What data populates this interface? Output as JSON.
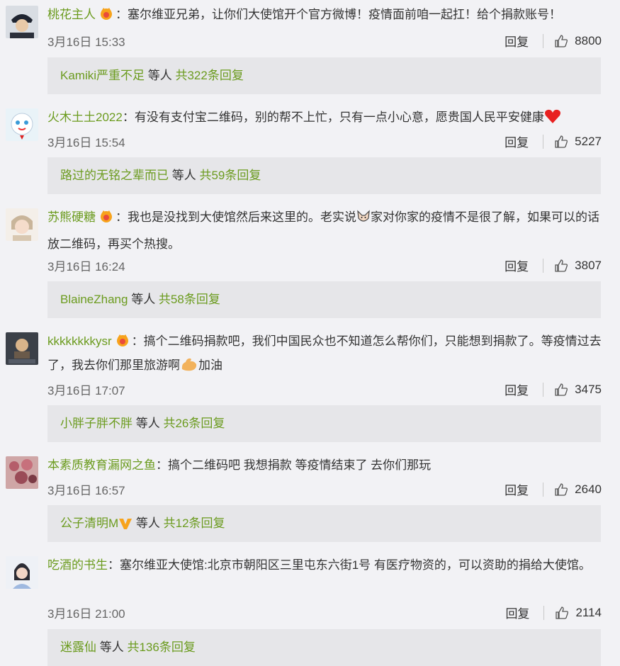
{
  "comments": [
    {
      "username": "桃花主人",
      "text": "：塞尔维亚兄弟，让你们大使馆开个官方微博！疫情面前咱一起扛！给个捐款账号！",
      "time": "3月16日 15:33",
      "reply_label": "回复",
      "likes": "8800",
      "replies": {
        "user": "Kamiki严重不足",
        "mid": " 等人 ",
        "count": "共322条回复"
      }
    },
    {
      "username": "火木土土2022",
      "text": "：有没有支付宝二维码，别的帮不上忙，只有一点小心意，愿贵国人民平安健康",
      "time": "3月16日 15:54",
      "reply_label": "回复",
      "likes": "5227",
      "replies": {
        "user": "路过的无铭之辈而已",
        "mid": " 等人 ",
        "count": "共59条回复"
      }
    },
    {
      "username": "苏熊硬糖",
      "text_a": "：我也是没找到大使馆然后来这里的。老实说",
      "text_b": "家对你家的疫情不是很了解，如果可以的话放二维码，再买个热搜。",
      "time": "3月16日 16:24",
      "reply_label": "回复",
      "likes": "3807",
      "replies": {
        "user": "BlaineZhang",
        "mid": " 等人 ",
        "count": "共58条回复"
      }
    },
    {
      "username": "kkkkkkkkysr",
      "text_a": "：搞个二维码捐款吧，我们中国民众也不知道怎么帮你们，只能想到捐款了。等疫情过去了，我去你们那里旅游啊",
      "text_b": "加油",
      "time": "3月16日 17:07",
      "reply_label": "回复",
      "likes": "3475",
      "replies": {
        "user": "小胖子胖不胖",
        "mid": " 等人 ",
        "count": "共26条回复"
      }
    },
    {
      "username": "本素质教育漏网之鱼",
      "text": "：搞个二维码吧 我想捐款 等疫情结束了 去你们那玩",
      "time": "3月16日 16:57",
      "reply_label": "回复",
      "likes": "2640",
      "replies": {
        "user": "公子清明M",
        "mid": " 等人 ",
        "count": "共12条回复"
      }
    },
    {
      "username": "吃酒的书生",
      "text": "：塞尔维亚大使馆:北京市朝阳区三里屯东六街1号 有医疗物资的，可以资助的捐给大使馆。",
      "time": "3月16日 21:00",
      "reply_label": "回复",
      "likes": "2114",
      "replies": {
        "user": "迷露仙",
        "mid": " 等人 ",
        "count": "共136条回复"
      }
    }
  ],
  "colors": {
    "username": "#6b9b1e",
    "reply_bg": "#e6e6e9",
    "page_bg": "#f2f2f5"
  },
  "icons": {
    "like": "thumbs-up-icon",
    "vip": "vip-crown-badge-icon",
    "heart": "red-heart-emoji",
    "muscle": "flexed-biceps-emoji",
    "fox": "fox-face-emoji",
    "verified": "v-verified-badge-icon"
  }
}
